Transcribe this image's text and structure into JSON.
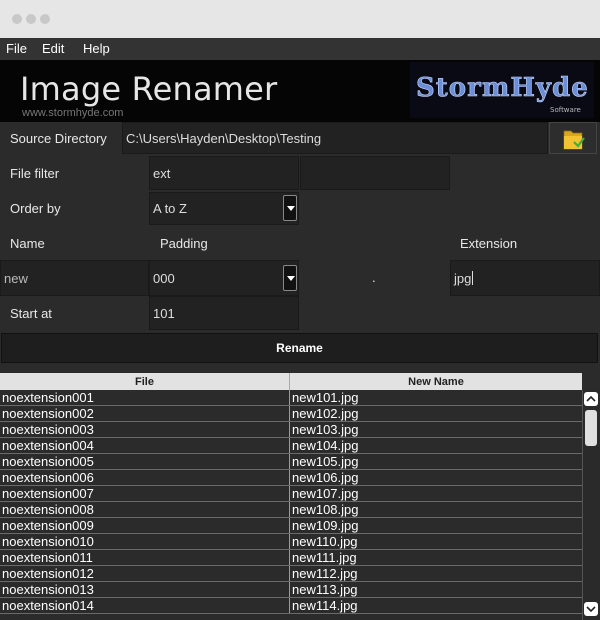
{
  "menu": {
    "items": [
      "File",
      "Edit",
      "Help"
    ]
  },
  "banner": {
    "title": "Image Renamer",
    "url": "www.stormhyde.com",
    "logo_text": "StormHyde",
    "logo_sub": "Software"
  },
  "form": {
    "source_label": "Source Directory",
    "source_value": "C:\\Users\\Hayden\\Desktop\\Testing",
    "filter_label": "File filter",
    "filter_value": "ext",
    "filter_value2": "",
    "order_label": "Order by",
    "order_value": "A to Z",
    "name_label": "Name",
    "padding_label": "Padding",
    "extension_label": "Extension",
    "name_value": "new",
    "padding_value": "000",
    "dot": ".",
    "extension_value": "jpg",
    "start_label": "Start at",
    "start_value": "101"
  },
  "rename_label": "Rename",
  "table": {
    "columns": [
      "File",
      "New Name"
    ],
    "rows": [
      [
        "noextension001",
        "new101.jpg"
      ],
      [
        "noextension002",
        "new102.jpg"
      ],
      [
        "noextension003",
        "new103.jpg"
      ],
      [
        "noextension004",
        "new104.jpg"
      ],
      [
        "noextension005",
        "new105.jpg"
      ],
      [
        "noextension006",
        "new106.jpg"
      ],
      [
        "noextension007",
        "new107.jpg"
      ],
      [
        "noextension008",
        "new108.jpg"
      ],
      [
        "noextension009",
        "new109.jpg"
      ],
      [
        "noextension010",
        "new110.jpg"
      ],
      [
        "noextension011",
        "new111.jpg"
      ],
      [
        "noextension012",
        "new112.jpg"
      ],
      [
        "noextension013",
        "new113.jpg"
      ],
      [
        "noextension014",
        "new114.jpg"
      ]
    ]
  },
  "colors": {
    "accent_logo": "#6b8fd6",
    "background": "#2b2b2b"
  }
}
